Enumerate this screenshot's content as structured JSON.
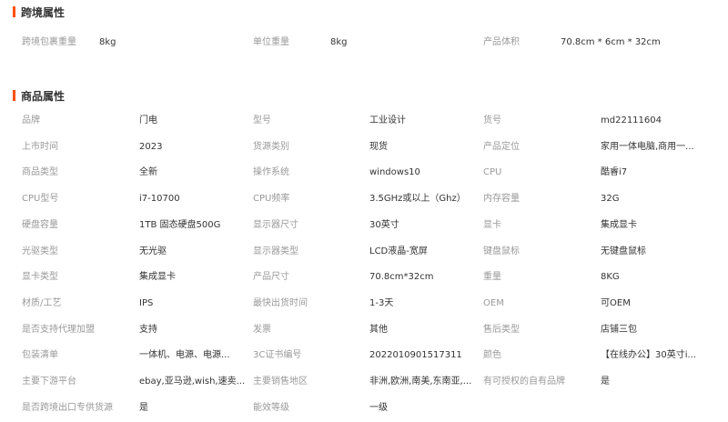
{
  "cross_border": {
    "title": "跨境属性",
    "items": [
      {
        "label": "跨境包裹重量",
        "value": "8kg"
      },
      {
        "label": "单位重量",
        "value": "8kg"
      },
      {
        "label": "产品体积",
        "value": "70.8cm * 6cm * 32cm"
      }
    ]
  },
  "product": {
    "title": "商品属性",
    "rows": [
      [
        {
          "label": "品牌",
          "value": "门电"
        },
        {
          "label": "型号",
          "value": "工业设计"
        },
        {
          "label": "货号",
          "value": "md22111604"
        }
      ],
      [
        {
          "label": "上市时间",
          "value": "2023"
        },
        {
          "label": "货源类别",
          "value": "现货"
        },
        {
          "label": "产品定位",
          "value": "家用一体电脑,商用一..."
        }
      ],
      [
        {
          "label": "商品类型",
          "value": "全新"
        },
        {
          "label": "操作系统",
          "value": "windows10"
        },
        {
          "label": "CPU",
          "value": "酷睿i7"
        }
      ],
      [
        {
          "label": "CPU型号",
          "value": "i7-10700"
        },
        {
          "label": "CPU频率",
          "value": "3.5GHz或以上（Ghz）"
        },
        {
          "label": "内存容量",
          "value": "32G"
        }
      ],
      [
        {
          "label": "硬盘容量",
          "value": "1TB 固态硬盘500G"
        },
        {
          "label": "显示器尺寸",
          "value": "30英寸"
        },
        {
          "label": "显卡",
          "value": "集成显卡"
        }
      ],
      [
        {
          "label": "光驱类型",
          "value": "无光驱"
        },
        {
          "label": "显示器类型",
          "value": "LCD液晶-宽屏"
        },
        {
          "label": "键盘鼠标",
          "value": "无键盘鼠标"
        }
      ],
      [
        {
          "label": "显卡类型",
          "value": "集成显卡"
        },
        {
          "label": "产品尺寸",
          "value": "70.8cm*32cm"
        },
        {
          "label": "重量",
          "value": "8KG"
        }
      ],
      [
        {
          "label": "材质/工艺",
          "value": "IPS"
        },
        {
          "label": "最快出货时间",
          "value": "1-3天"
        },
        {
          "label": "OEM",
          "value": "可OEM"
        }
      ],
      [
        {
          "label": "是否支持代理加盟",
          "value": "支持"
        },
        {
          "label": "发票",
          "value": "其他"
        },
        {
          "label": "售后类型",
          "value": "店铺三包"
        }
      ],
      [
        {
          "label": "包装清单",
          "value": "一体机、电源、电源..."
        },
        {
          "label": "3C证书编号",
          "value": "2022010901517311"
        },
        {
          "label": "颜色",
          "value": "【在线办公】30英寸i..."
        }
      ],
      [
        {
          "label": "主要下游平台",
          "value": "ebay,亚马逊,wish,速卖..."
        },
        {
          "label": "主要销售地区",
          "value": "非洲,欧洲,南美,东南亚,..."
        },
        {
          "label": "有可授权的自有品牌",
          "value": "是"
        }
      ],
      [
        {
          "label": "是否跨境出口专供货源",
          "value": "是"
        },
        {
          "label": "能效等级",
          "value": "一级"
        }
      ]
    ]
  }
}
